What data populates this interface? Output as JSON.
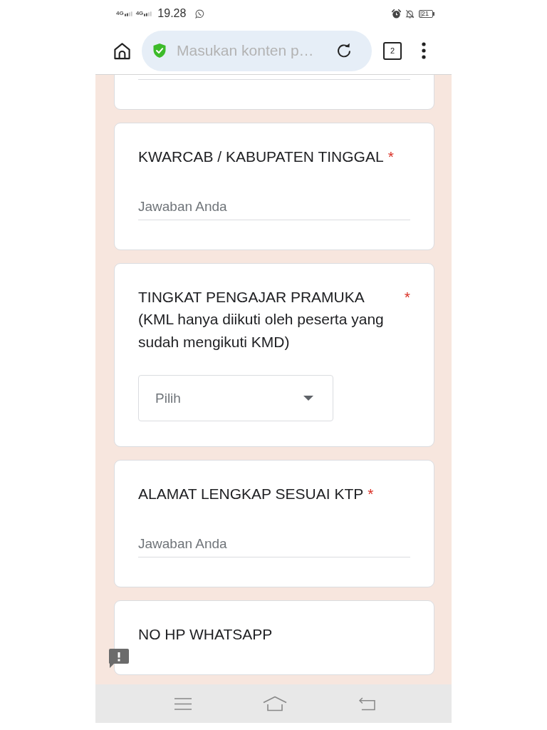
{
  "status_bar": {
    "signals": [
      {
        "network": "4G"
      },
      {
        "network": "4G"
      }
    ],
    "time": "19.28",
    "battery": "21"
  },
  "browser_toolbar": {
    "address_field": {
      "placeholder": "Masukan konten p…"
    },
    "tab_count": "2"
  },
  "questions": [
    {
      "kind": "text"
    },
    {
      "kind": "text",
      "title": "KWARCAB / KABUPATEN TINGGAL",
      "required_mark": "*",
      "placeholder": "Jawaban Anda"
    },
    {
      "kind": "dropdown",
      "title": "TINGKAT PENGAJAR PRAMUKA (KML hanya diikuti oleh peserta yang sudah mengikuti KMD)",
      "required_mark": "*",
      "placeholder": "Pilih"
    },
    {
      "kind": "text",
      "title": "ALAMAT LENGKAP SESUAI KTP",
      "required_mark": "*",
      "placeholder": "Jawaban Anda"
    },
    {
      "kind": "text",
      "title": "NO HP WHATSAPP"
    }
  ]
}
